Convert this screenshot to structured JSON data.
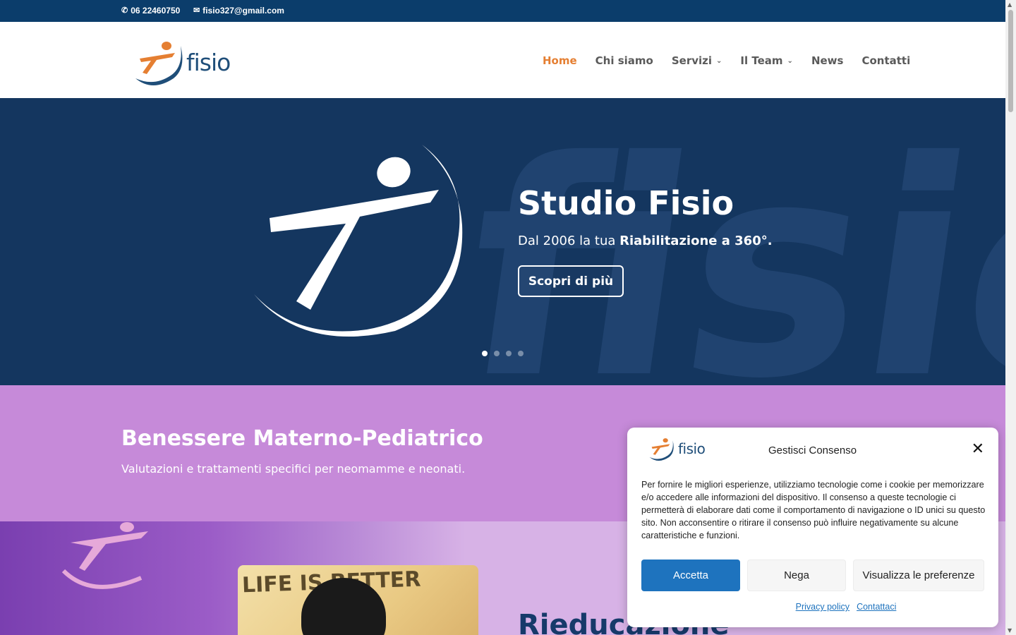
{
  "topbar": {
    "phone": "06 22460750",
    "email": "fisio327@gmail.com"
  },
  "header": {
    "logo_text": "fisio",
    "nav": {
      "home": "Home",
      "chi_siamo": "Chi siamo",
      "servizi": "Servizi",
      "il_team": "Il Team",
      "news": "News",
      "contatti": "Contatti"
    }
  },
  "hero": {
    "title": "Studio Fisio",
    "subtitle_prefix": "Dal 2006 la tua ",
    "subtitle_bold": "Riabilitazione a 360°.",
    "button": "Scopri di più",
    "slides": 4,
    "active_slide": 1,
    "background_text": "fisio"
  },
  "band": {
    "title": "Benessere Materno-Pediatrico",
    "subtitle": "Valutazioni e trattamenti specifici per neomamme e neonati."
  },
  "lower": {
    "card_text": "LIFE IS BETTER",
    "heading": "Rieducazione"
  },
  "cookie": {
    "logo_text": "fisio",
    "title": "Gestisci Consenso",
    "close": "✕",
    "text": "Per fornire le migliori esperienze, utilizziamo tecnologie come i cookie per memorizzare e/o accedere alle informazioni del dispositivo. Il consenso a queste tecnologie ci permetterà di elaborare dati come il comportamento di navigazione o ID unici su questo sito. Non acconsentire o ritirare il consenso può influire negativamente su alcune caratteristiche e funzioni.",
    "accept": "Accetta",
    "deny": "Nega",
    "preferences": "Visualizza le preferenze",
    "privacy_link": "Privacy policy",
    "contact_link": "Contattaci"
  },
  "colors": {
    "topbar": "#0b3d6b",
    "nav_active": "#e57f32",
    "hero_bg": "#173b66",
    "band_bg": "#c68ad9",
    "accept_button": "#1e73be"
  },
  "icons": {
    "phone": "phone-icon",
    "email": "envelope-icon",
    "dropdown": "chevron-down-icon",
    "close": "close-icon"
  }
}
